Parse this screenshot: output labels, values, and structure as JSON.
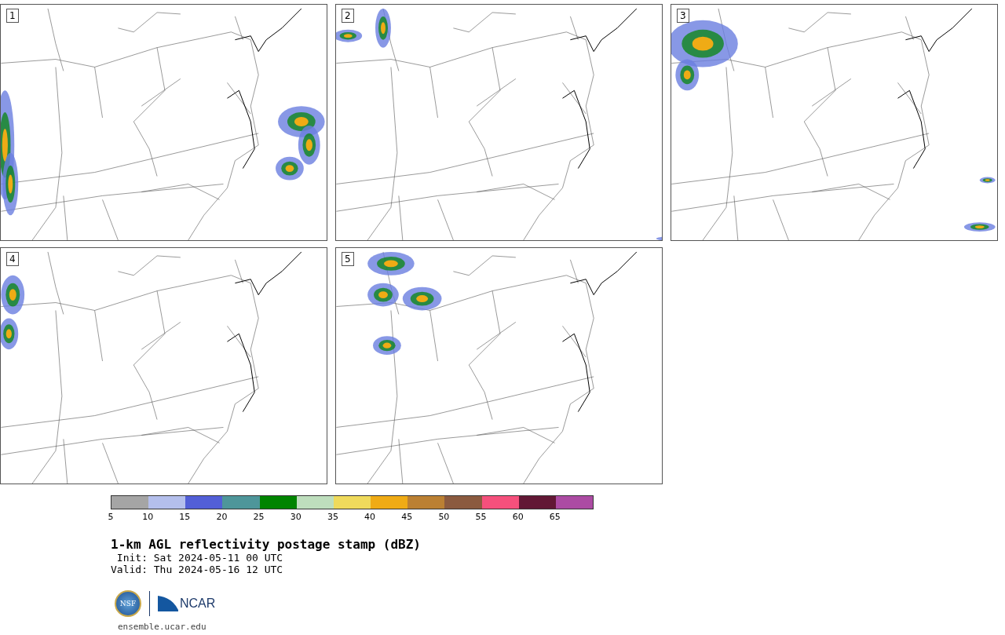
{
  "panels": [
    {
      "label": "1"
    },
    {
      "label": "2"
    },
    {
      "label": "3"
    },
    {
      "label": "4"
    },
    {
      "label": "5"
    }
  ],
  "colorbar": {
    "bins": [
      {
        "color": "#a5a5a5"
      },
      {
        "color": "#b4bfec"
      },
      {
        "color": "#525fd7"
      },
      {
        "color": "#4e969a"
      },
      {
        "color": "#008400"
      },
      {
        "color": "#bedebd"
      },
      {
        "color": "#efda5c"
      },
      {
        "color": "#efab15"
      },
      {
        "color": "#bb8033"
      },
      {
        "color": "#8b5a3f"
      },
      {
        "color": "#f5507c"
      },
      {
        "color": "#621835"
      },
      {
        "color": "#ac4ba3"
      }
    ],
    "ticks": [
      "5",
      "10",
      "15",
      "20",
      "25",
      "30",
      "35",
      "40",
      "45",
      "50",
      "55",
      "60",
      "65"
    ]
  },
  "title": "1-km AGL reflectivity postage stamp (dBZ)",
  "init": " Init: Sat 2024-05-11 00 UTC",
  "valid": "Valid: Thu 2024-05-16 12 UTC",
  "logos": {
    "nsf": "NSF",
    "ncar": "NCAR"
  },
  "url": "ensemble.ucar.edu"
}
